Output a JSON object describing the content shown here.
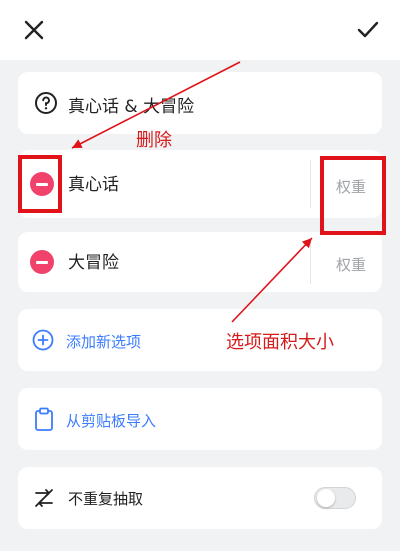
{
  "title_row": {
    "text": "真心话 & 大冒险"
  },
  "options": [
    {
      "label": "真心话",
      "weight_label": "权重"
    },
    {
      "label": "大冒险",
      "weight_label": "权重"
    }
  ],
  "add_option_label": "添加新选项",
  "import_label": "从剪贴板导入",
  "no_repeat": {
    "label": "不重复抽取",
    "enabled": false
  },
  "annotations": {
    "delete": "删除",
    "area": "选项面积大小"
  },
  "colors": {
    "accent_blue": "#3b7cff",
    "delete_red": "#f0426b",
    "annotation_red": "#e0131a",
    "background": "#f1f2f4"
  },
  "icons": [
    "close-icon",
    "check-icon",
    "question-circle-icon",
    "minus-circle-icon",
    "plus-circle-icon",
    "clipboard-icon",
    "shuffle-icon"
  ]
}
